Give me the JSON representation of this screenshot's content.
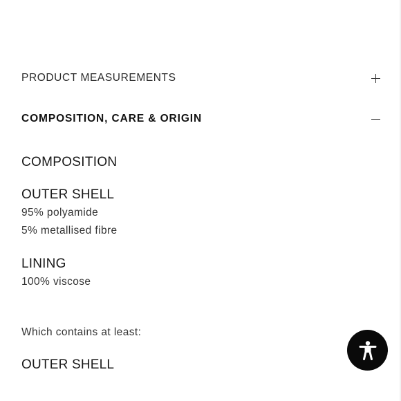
{
  "accordion": {
    "product_measurements": {
      "label": "PRODUCT MEASUREMENTS",
      "icon": "plus-icon"
    },
    "composition_care_origin": {
      "label": "COMPOSITION, CARE & ORIGIN",
      "icon": "minus-icon"
    }
  },
  "composition": {
    "title": "COMPOSITION",
    "outer_shell": {
      "title": "OUTER SHELL",
      "lines": [
        "95% polyamide",
        "5% metallised fibre"
      ]
    },
    "lining": {
      "title": "LINING",
      "lines": [
        "100% viscose"
      ]
    },
    "contains_note": "Which contains at least:",
    "outer_shell_2": {
      "title": "OUTER SHELL"
    }
  },
  "accessibility_button": {
    "icon": "accessibility-icon"
  }
}
